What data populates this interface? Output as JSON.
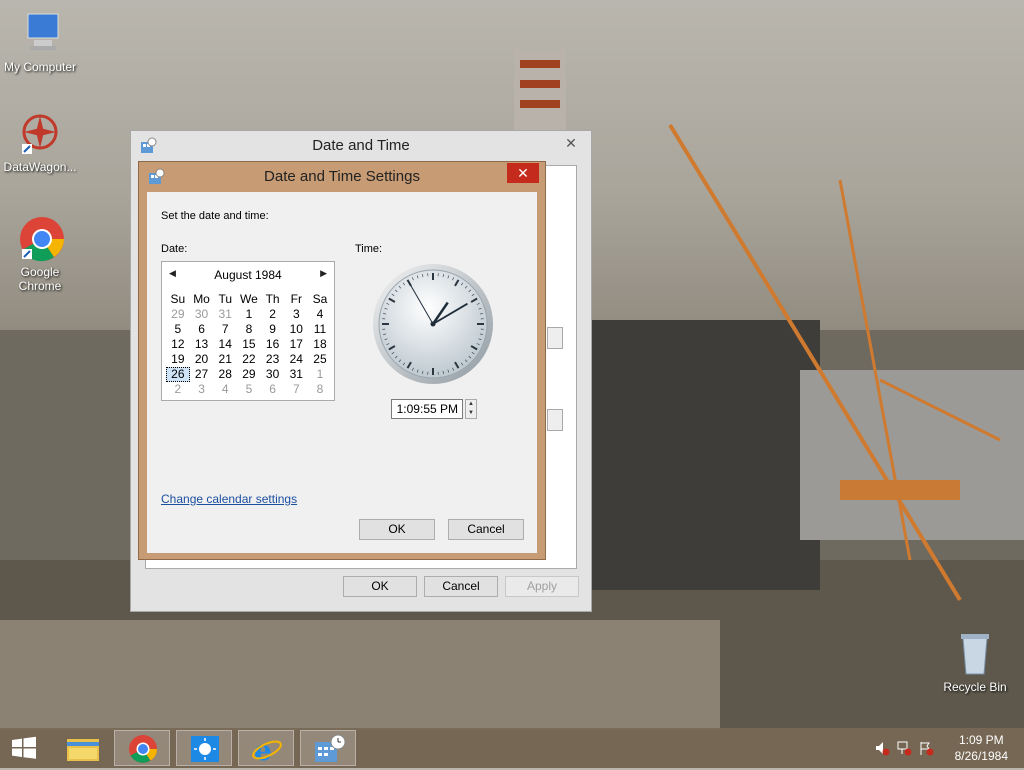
{
  "desktop": {
    "icons": [
      {
        "label": "My Computer"
      },
      {
        "label": "DataWagon..."
      },
      {
        "label": "Google Chrome"
      },
      {
        "label": "Recycle Bin"
      }
    ]
  },
  "outer_window": {
    "title": "Date and Time",
    "ok_label": "OK",
    "cancel_label": "Cancel",
    "apply_label": "Apply"
  },
  "dialog": {
    "title": "Date and Time Settings",
    "instruction": "Set the date and time:",
    "date_label": "Date:",
    "time_label": "Time:",
    "time_value": "1:09:55 PM",
    "link_text": "Change calendar settings",
    "ok_label": "OK",
    "cancel_label": "Cancel"
  },
  "calendar": {
    "month_label": "August 1984",
    "weekdays": [
      "Su",
      "Mo",
      "Tu",
      "We",
      "Th",
      "Fr",
      "Sa"
    ],
    "weeks": [
      [
        [
          "29",
          true
        ],
        [
          "30",
          true
        ],
        [
          "31",
          true
        ],
        [
          "1",
          false
        ],
        [
          "2",
          false
        ],
        [
          "3",
          false
        ],
        [
          "4",
          false
        ]
      ],
      [
        [
          "5",
          false
        ],
        [
          "6",
          false
        ],
        [
          "7",
          false
        ],
        [
          "8",
          false
        ],
        [
          "9",
          false
        ],
        [
          "10",
          false
        ],
        [
          "11",
          false
        ]
      ],
      [
        [
          "12",
          false
        ],
        [
          "13",
          false
        ],
        [
          "14",
          false
        ],
        [
          "15",
          false
        ],
        [
          "16",
          false
        ],
        [
          "17",
          false
        ],
        [
          "18",
          false
        ]
      ],
      [
        [
          "19",
          false
        ],
        [
          "20",
          false
        ],
        [
          "21",
          false
        ],
        [
          "22",
          false
        ],
        [
          "23",
          false
        ],
        [
          "24",
          false
        ],
        [
          "25",
          false
        ]
      ],
      [
        [
          "26",
          false
        ],
        [
          "27",
          false
        ],
        [
          "28",
          false
        ],
        [
          "29",
          false
        ],
        [
          "30",
          false
        ],
        [
          "31",
          false
        ],
        [
          "1",
          true
        ]
      ],
      [
        [
          "2",
          true
        ],
        [
          "3",
          true
        ],
        [
          "4",
          true
        ],
        [
          "5",
          true
        ],
        [
          "6",
          true
        ],
        [
          "7",
          true
        ],
        [
          "8",
          true
        ]
      ]
    ],
    "selected_day": "26"
  },
  "analog_clock": {
    "hour": 1,
    "minute": 9,
    "second": 55
  },
  "taskbar": {
    "time": "1:09 PM",
    "date": "8/26/1984",
    "pinned": [
      "windows-start-icon",
      "file-explorer-icon",
      "chrome-icon",
      "weather-icon",
      "internet-explorer-icon",
      "date-time-icon"
    ]
  },
  "colors": {
    "dialog_frame": "#c79b73",
    "close_red": "#c42b1c",
    "link": "#1c4fa0"
  }
}
